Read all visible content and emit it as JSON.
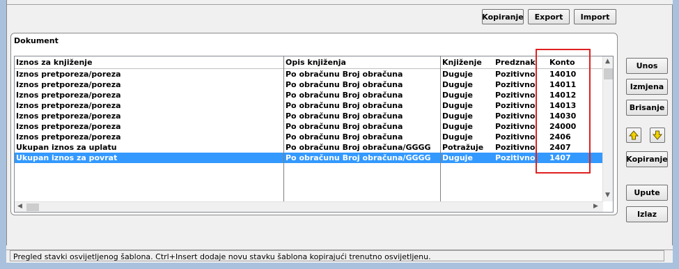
{
  "toolbar": {
    "copy": "Kopiranje",
    "export": "Export",
    "import": "Import"
  },
  "document": {
    "title": "Dokument",
    "columns": [
      "Iznos za knjiženje",
      "Opis knjiženja",
      "Knjiženje",
      "Predznak",
      "Konto"
    ],
    "rows": [
      [
        "Iznos pretporeza/poreza",
        "Po obračunu Broj obračuna",
        "Duguje",
        "Pozitivno",
        "14010"
      ],
      [
        "Iznos pretporeza/poreza",
        "Po obračunu Broj obračuna",
        "Duguje",
        "Pozitivno",
        "14011"
      ],
      [
        "Iznos pretporeza/poreza",
        "Po obračunu Broj obračuna",
        "Duguje",
        "Pozitivno",
        "14012"
      ],
      [
        "Iznos pretporeza/poreza",
        "Po obračunu Broj obračuna",
        "Duguje",
        "Pozitivno",
        "14013"
      ],
      [
        "Iznos pretporeza/poreza",
        "Po obračunu Broj obračuna",
        "Duguje",
        "Pozitivno",
        "14030"
      ],
      [
        "Iznos pretporeza/poreza",
        "Po obračunu Broj obračuna",
        "Duguje",
        "Pozitivno",
        "24000"
      ],
      [
        "Iznos pretporeza/poreza",
        "Po obračunu Broj obračuna",
        "Duguje",
        "Pozitivno",
        "2406"
      ],
      [
        "Ukupan iznos za uplatu",
        "Po obračunu Broj obračuna/GGGG",
        "Potražuje",
        "Pozitivno",
        "2407"
      ],
      [
        "Ukupan iznos za povrat",
        "Po obračunu Broj obračuna/GGGG",
        "Duguje",
        "Pozitivno",
        "1407"
      ]
    ],
    "selected_row": 8
  },
  "side": {
    "entry": "Unos",
    "edit": "Izmjena",
    "delete": "Brisanje",
    "copy": "Kopiranje",
    "instructions": "Upute",
    "exit": "Izlaz"
  },
  "status": {
    "text": "Pregled stavki osvijetljenog šablona. Ctrl+Insert dodaje novu stavku šablona kopirajući trenutno osvijetljenu."
  },
  "colors": {
    "selection": "#3399ff",
    "highlight_box": "#e02020",
    "arrow_icon": "#f2d200"
  },
  "icons": {
    "up": "arrow-up-icon",
    "down": "arrow-down-icon"
  }
}
